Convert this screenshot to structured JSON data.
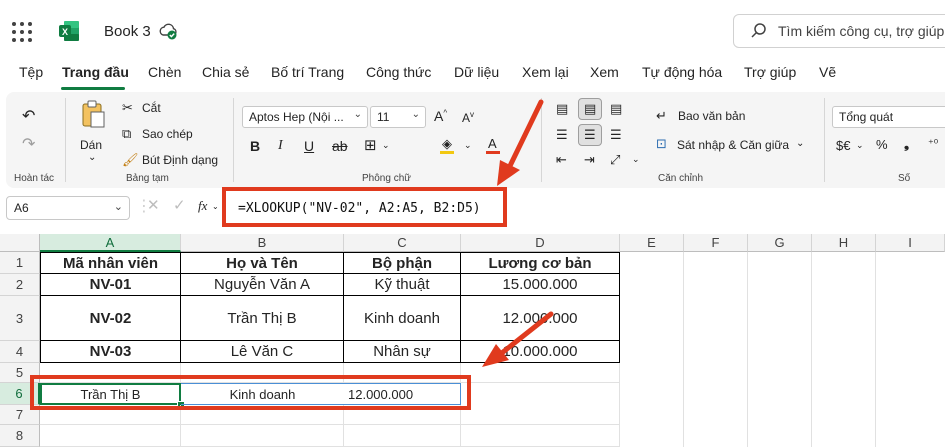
{
  "app": {
    "title": "Book 3",
    "search_placeholder": "Tìm kiếm công cụ, trợ giúp"
  },
  "menu": [
    "Tệp",
    "Trang đầu",
    "Chèn",
    "Chia sẻ",
    "Bố trí Trang",
    "Công thức",
    "Dữ liệu",
    "Xem lại",
    "Xem",
    "Tự động hóa",
    "Trợ giúp",
    "Vẽ"
  ],
  "menu_active": "Trang đầu",
  "ribbon": {
    "groups": {
      "undo": "Hoàn tác",
      "clipboard": "Bảng tạm",
      "font": "Phông chữ",
      "alignment": "Căn chỉnh",
      "number": "Số"
    },
    "paste": "Dán",
    "cut": "Cắt",
    "copy": "Sao chép",
    "format_painter": "Bút Định dạng",
    "font_name": "Aptos Hep (Nội ...",
    "font_size": "11",
    "wrap_text": "Bao văn bản",
    "merge_center": "Sát nhập & Căn giữa",
    "number_format": "Tổng quát",
    "number_symbols": "$€"
  },
  "formula_bar": {
    "name_box": "A6",
    "fx": "fx",
    "formula": "=XLOOKUP(\"NV-02\", A2:A5, B2:D5)"
  },
  "sheet": {
    "columns": [
      "A",
      "B",
      "C",
      "D",
      "E",
      "F",
      "G",
      "H",
      "I"
    ],
    "rows": [
      "1",
      "2",
      "3",
      "4",
      "5",
      "6",
      "7",
      "8"
    ],
    "header": [
      "Mã nhân viên",
      "Họ và Tên",
      "Bộ phận",
      "Lương cơ bản"
    ],
    "data": [
      [
        "NV-01",
        "Nguyễn Văn A",
        "Kỹ thuật",
        "15.000.000"
      ],
      [
        "NV-02",
        "Trần Thị B",
        "Kinh doanh",
        "12.000.000"
      ],
      [
        "NV-03",
        "Lê Văn C",
        "Nhân sự",
        "10.000.000"
      ]
    ],
    "result": [
      "Trần Thị B",
      "Kinh doanh",
      "12.000.000"
    ]
  },
  "colors": {
    "accent": "#107c41",
    "highlight": "#e03a1e"
  }
}
